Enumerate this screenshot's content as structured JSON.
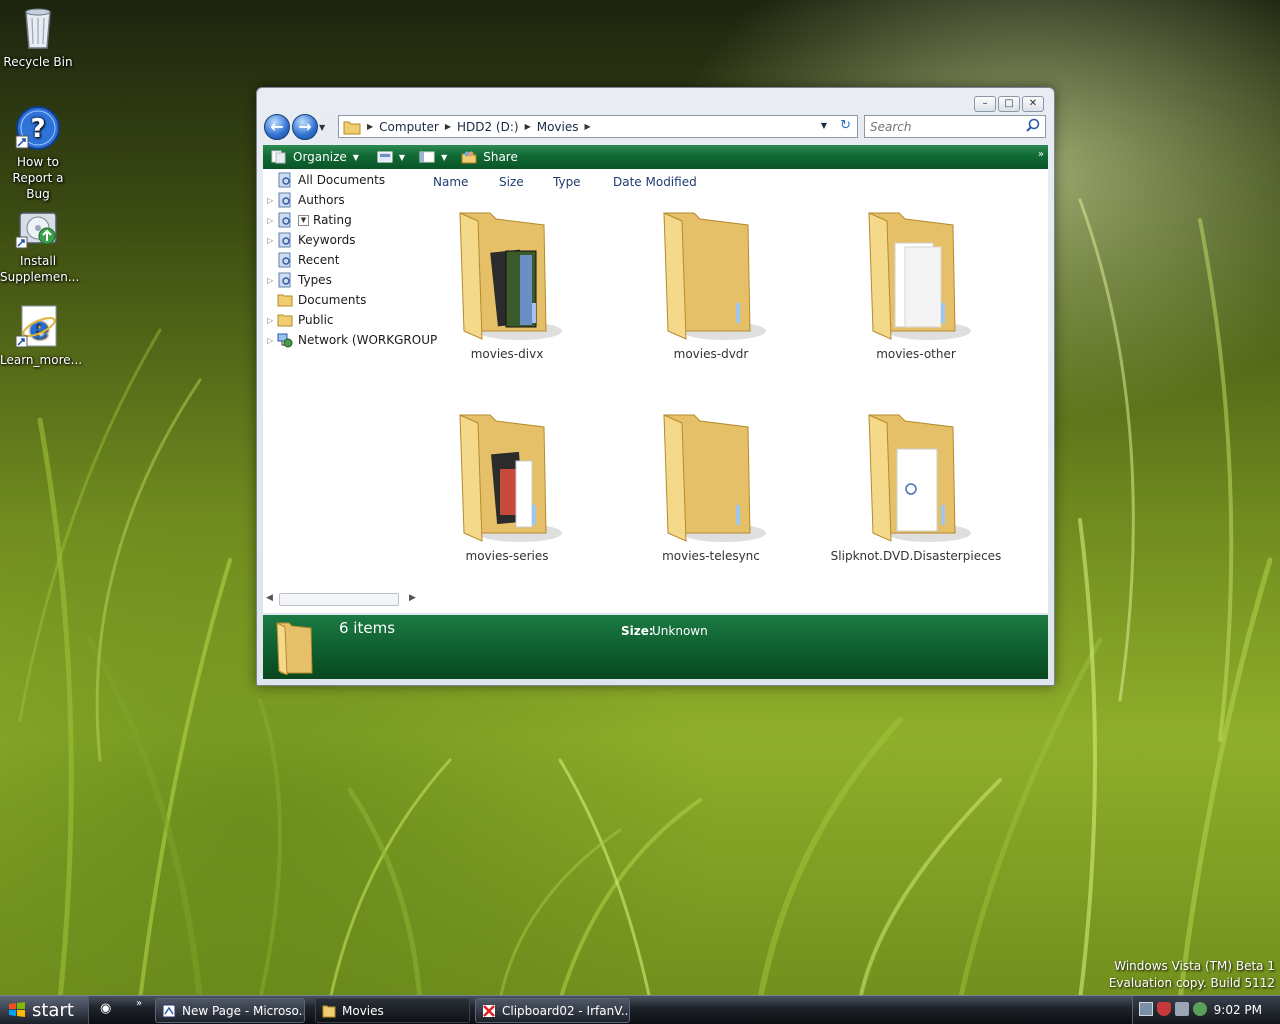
{
  "desktop": {
    "icons": [
      {
        "label": "Recycle Bin",
        "icon": "recycle-bin-icon"
      },
      {
        "label": "How to Report a Bug",
        "icon": "help-icon"
      },
      {
        "label": "Install Supplemen...",
        "icon": "install-icon"
      },
      {
        "label": "Learn_more...",
        "icon": "internet-explorer-icon"
      }
    ],
    "watermark": {
      "line1": "Windows Vista (TM) Beta 1",
      "line2": "Evaluation copy. Build 5112"
    }
  },
  "window": {
    "controls": {
      "minimize": "–",
      "maximize": "□",
      "close": "✕"
    },
    "address": {
      "crumbs": [
        "Computer",
        "HDD2 (D:)",
        "Movies"
      ]
    },
    "search": {
      "placeholder": "Search"
    },
    "toolbar": {
      "organize": "Organize",
      "share": "Share"
    },
    "nav_pane": [
      {
        "label": "All Documents",
        "icon": "saved-search-icon",
        "expandable": false
      },
      {
        "label": "Authors",
        "icon": "saved-search-icon",
        "expandable": true
      },
      {
        "label": "Rating",
        "icon": "saved-search-icon",
        "expandable": true
      },
      {
        "label": "Keywords",
        "icon": "saved-search-icon",
        "expandable": true
      },
      {
        "label": "Recent",
        "icon": "saved-search-icon",
        "expandable": false
      },
      {
        "label": "Types",
        "icon": "saved-search-icon",
        "expandable": true
      },
      {
        "label": "Documents",
        "icon": "folder-icon",
        "expandable": false
      },
      {
        "label": "Public",
        "icon": "folder-icon",
        "expandable": true
      },
      {
        "label": "Network (WORKGROUP",
        "icon": "network-icon",
        "expandable": true
      }
    ],
    "columns": [
      "Name",
      "Size",
      "Type",
      "Date Modified"
    ],
    "folders": [
      {
        "name": "movies-divx",
        "content": "film"
      },
      {
        "name": "movies-dvdr",
        "content": "empty"
      },
      {
        "name": "movies-other",
        "content": "pages"
      },
      {
        "name": "movies-series",
        "content": "film"
      },
      {
        "name": "movies-telesync",
        "content": "empty"
      },
      {
        "name": "Slipknot.DVD.Disasterpieces",
        "content": "pages"
      }
    ],
    "details": {
      "count": "6 items",
      "size_label": "Size:",
      "size_value": "Unknown"
    }
  },
  "taskbar": {
    "start": "start",
    "tasks": [
      {
        "label": "New Page - Microso..."
      },
      {
        "label": "Movies"
      },
      {
        "label": "Clipboard02 - IrfanV..."
      }
    ],
    "clock": "9:02 PM"
  },
  "colors": {
    "toolbar_green": "#116a34",
    "details_green": "#0e5e2f",
    "folder_yellow": "#f2d27a"
  }
}
